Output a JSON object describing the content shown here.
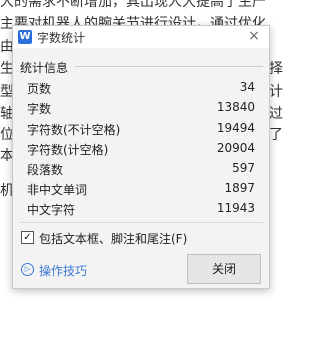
{
  "background": {
    "lines": [
      "大的需求不断增加，其出现人大提高了生产",
      "主要对机器人的腕关节进行设计，通过优化",
      "由",
      "生",
      "型",
      "轴",
      "位",
      "本",
      "机"
    ],
    "right_chars": [
      "计",
      "择",
      "计",
      "过",
      "了"
    ]
  },
  "dialog": {
    "app_icon": "W",
    "title": "字数统计",
    "close_icon": "×",
    "section_title": "统计信息",
    "stats": [
      {
        "label": "页数",
        "value": "34"
      },
      {
        "label": "字数",
        "value": "13840"
      },
      {
        "label": "字符数(不计空格)",
        "value": "19494"
      },
      {
        "label": "字符数(计空格)",
        "value": "20904"
      },
      {
        "label": "段落数",
        "value": "597"
      },
      {
        "label": "非中文单词",
        "value": "1897"
      },
      {
        "label": "中文字符",
        "value": "11943"
      }
    ],
    "checkbox": {
      "checked": true,
      "mark": "✓",
      "label": "包括文本框、脚注和尾注(F)"
    },
    "tips_icon": "▷",
    "tips_label": "操作技巧",
    "close_button": "关闭"
  }
}
